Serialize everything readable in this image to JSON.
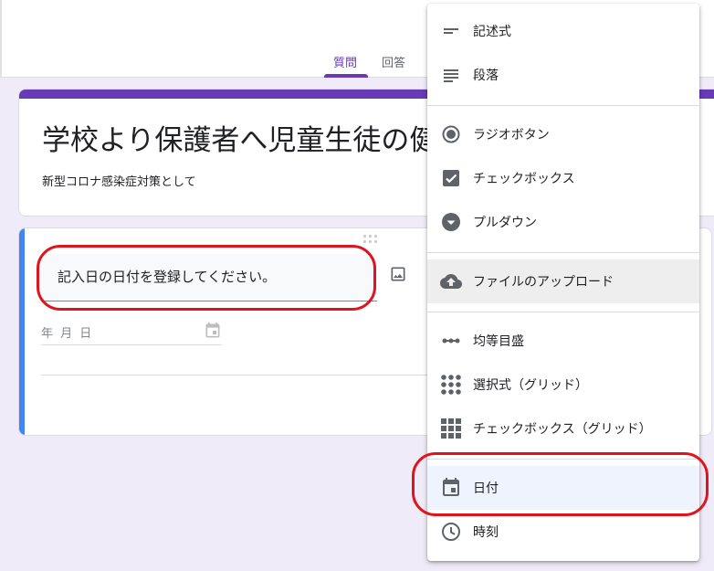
{
  "tabs": {
    "questions": "質問",
    "responses": "回答"
  },
  "form": {
    "title": "学校より保護者へ児童生徒の健",
    "description": "新型コロナ感染症対策として"
  },
  "question": {
    "text": "記入日の日付を登録してください。",
    "date_placeholder": "年 月 日"
  },
  "menu": {
    "short_answer": "記述式",
    "paragraph": "段落",
    "multiple_choice": "ラジオボタン",
    "checkboxes": "チェックボックス",
    "dropdown": "プルダウン",
    "file_upload": "ファイルのアップロード",
    "linear_scale": "均等目盛",
    "mc_grid": "選択式（グリッド）",
    "checkbox_grid": "チェックボックス（グリッド）",
    "date": "日付",
    "time": "時刻"
  },
  "colors": {
    "accent": "#673ab7",
    "highlight_ring": "#e0141e",
    "question_bar": "#4285f4"
  }
}
